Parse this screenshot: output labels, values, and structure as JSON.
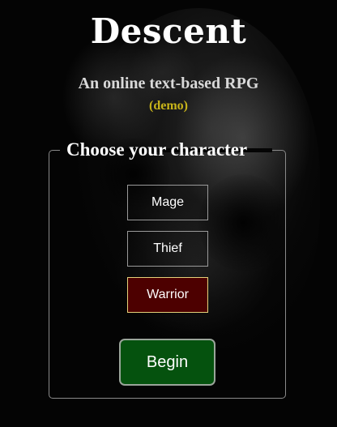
{
  "header": {
    "title": "Descent",
    "subtitle": "An online text-based RPG",
    "tag": "(demo)"
  },
  "character_select": {
    "legend": "Choose your character",
    "options": [
      {
        "label": "Mage",
        "selected": false
      },
      {
        "label": "Thief",
        "selected": false
      },
      {
        "label": "Warrior",
        "selected": true
      }
    ],
    "begin_label": "Begin"
  },
  "colors": {
    "background": "#000000",
    "tag": "#c8b41a",
    "selected_fill": "#4d0000",
    "selected_border": "#e6d27a",
    "begin_fill": "#05520e"
  }
}
